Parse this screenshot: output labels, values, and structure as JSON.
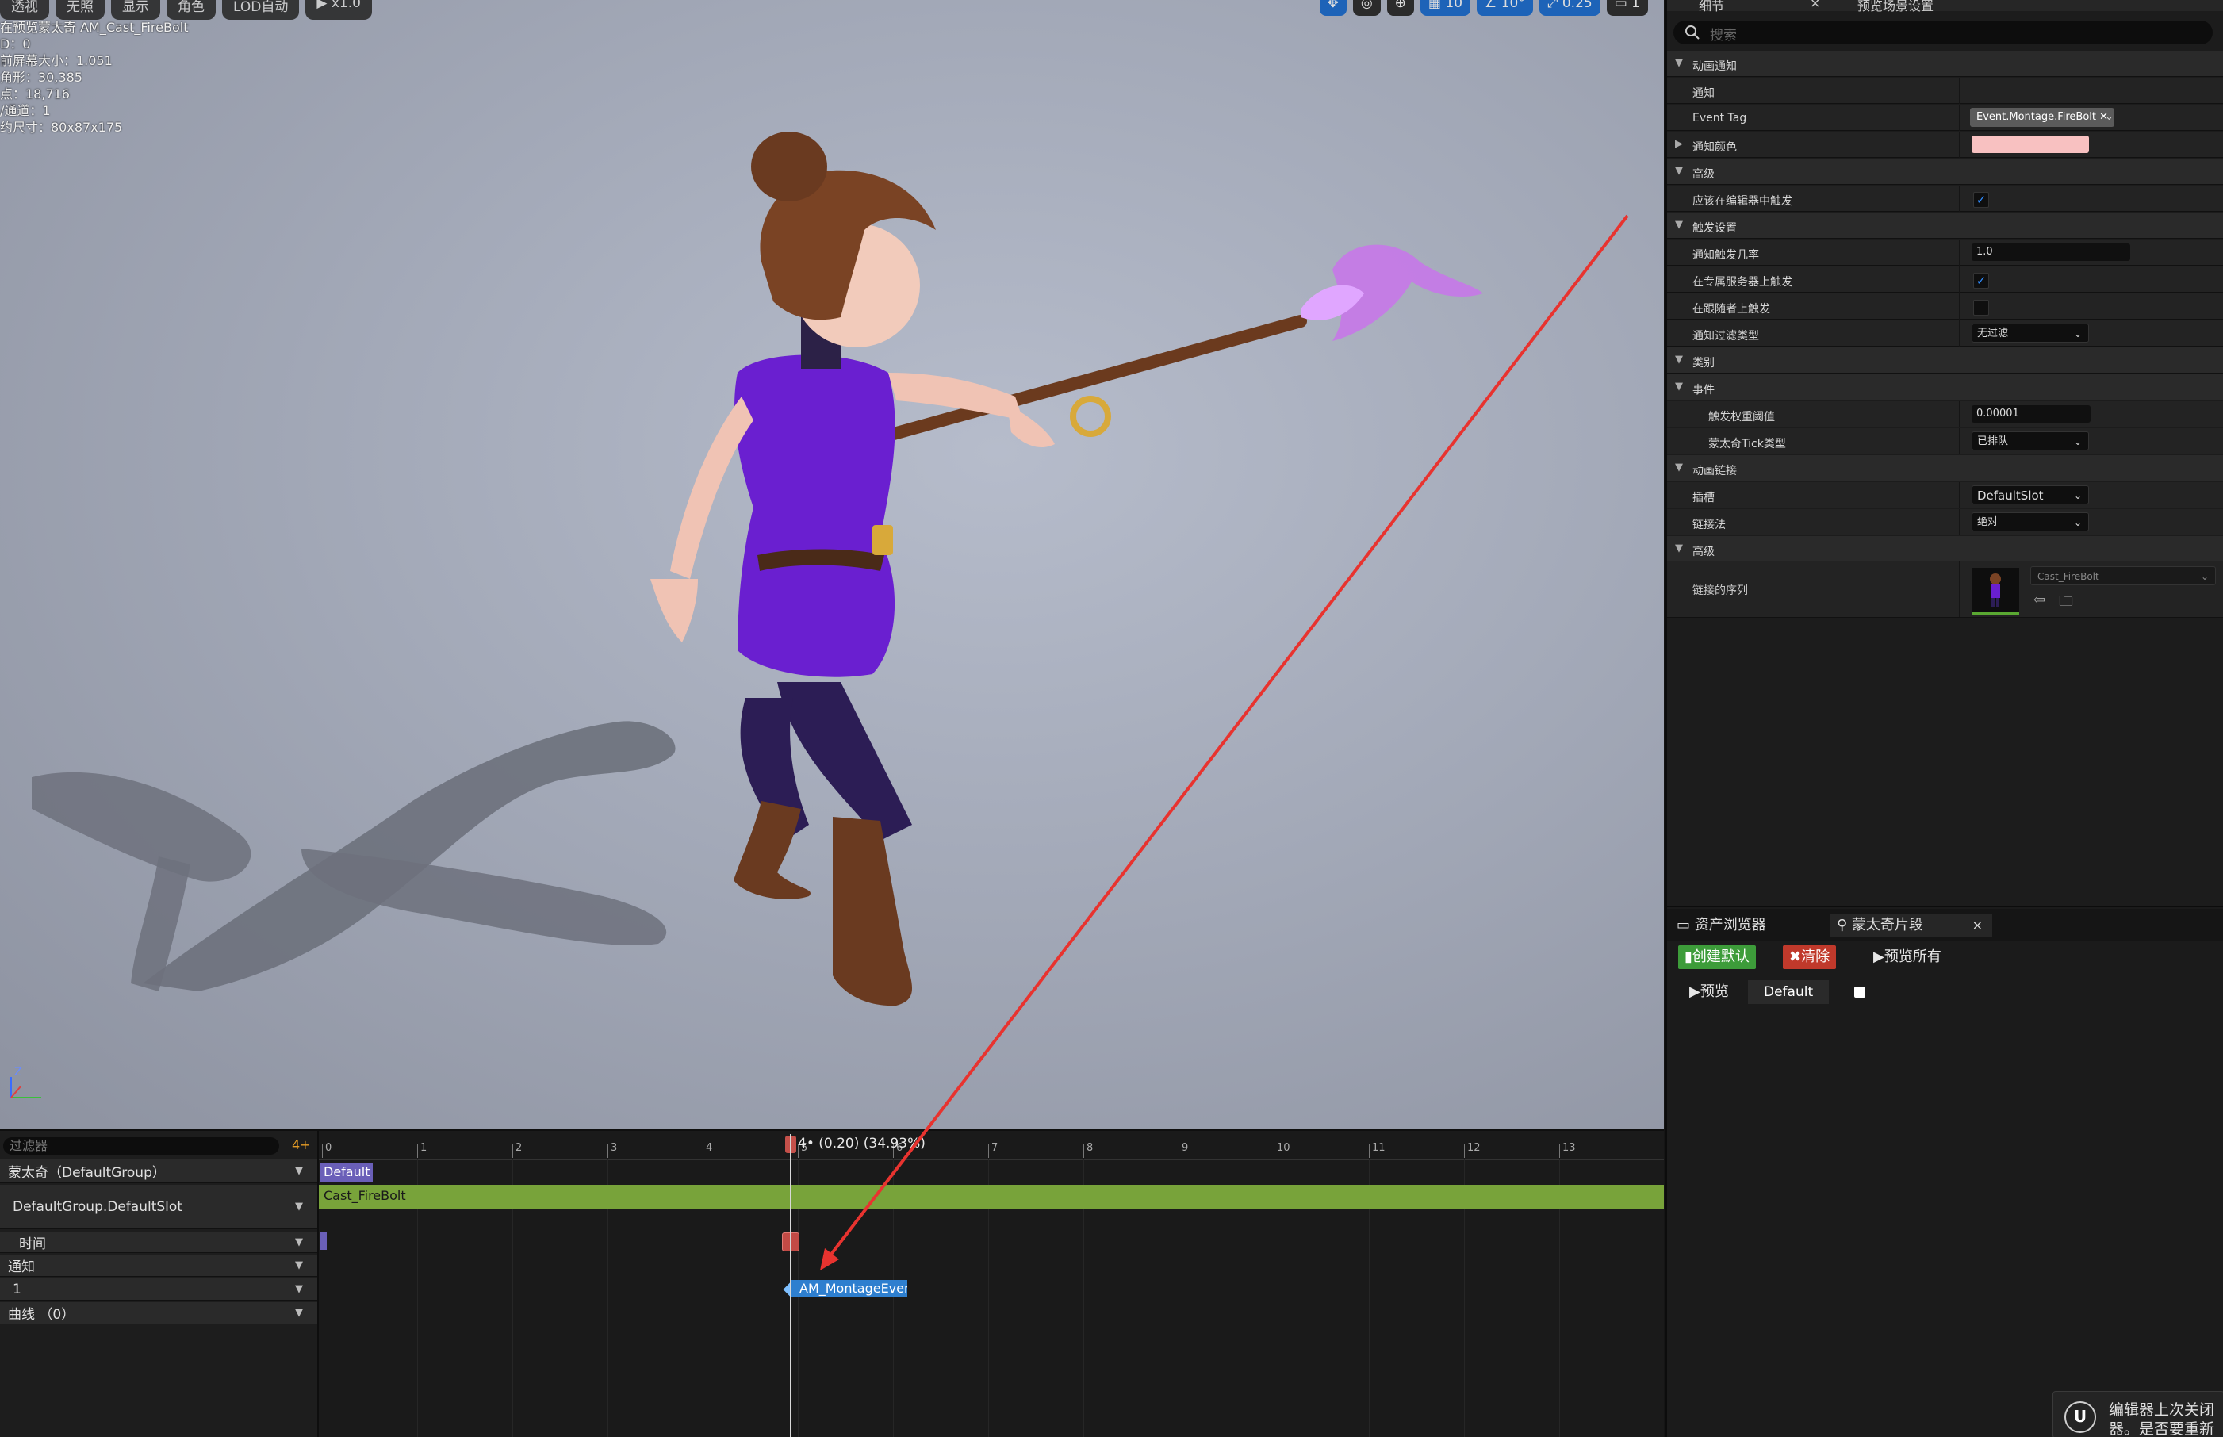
{
  "viewport": {
    "toolbar": [
      "透视",
      "无照",
      "显示",
      "角色",
      "LOD自动",
      "x1.0"
    ],
    "right_tools": [
      "10",
      "10°",
      "0.25",
      "1"
    ],
    "stats": [
      "在预览蒙太奇 AM_Cast_FireBolt",
      "D：0",
      "前屏幕大小：1.051",
      "角形：30,385",
      "点：18,716",
      "/通道：1",
      "约尺寸：80x87x175"
    ],
    "gizmo": "Z"
  },
  "timeline": {
    "filter_placeholder": "过滤器",
    "filter_add": "4+",
    "tracks": [
      {
        "label": "蒙太奇（DefaultGroup）"
      },
      {
        "label": "DefaultGroup.DefaultSlot"
      },
      {
        "label": "时间"
      },
      {
        "label": "通知"
      },
      {
        "label": "1"
      },
      {
        "label": "曲线 （0）"
      }
    ],
    "ticks": [
      "0",
      "1",
      "2",
      "3",
      "4",
      "5",
      "6",
      "7",
      "8",
      "9",
      "10",
      "11",
      "12",
      "13"
    ],
    "scrub_label": "4• (0.20) (34.93%)",
    "default_section": "Default",
    "segment_name": "Cast_FireBolt",
    "notify_name": "AM_MontageEvent",
    "colors": {
      "segment": "#78a33a",
      "notify": "#2e7fcf",
      "marker": "#c24a45",
      "section": "#6a5fb8"
    }
  },
  "details": {
    "tab1": "细节",
    "tab2": "预览场景设置",
    "search_placeholder": "搜索",
    "rows": {
      "anim_notify": "动画通知",
      "notify": "通知",
      "event_tag": "Event Tag",
      "event_tag_value": "Event.Montage.FireBolt",
      "notify_color": "通知颜色",
      "advanced": "高级",
      "trigger_in_editor": "应该在编辑器中触发",
      "trigger_settings": "触发设置",
      "trigger_chance": "通知触发几率",
      "trigger_chance_value": "1.0",
      "trigger_dedicated": "在专属服务器上触发",
      "trigger_follower": "在跟随者上触发",
      "filter_type": "通知过滤类型",
      "filter_type_value": "无过滤",
      "category": "类别",
      "event": "事件",
      "weight_threshold": "触发权重阈值",
      "weight_threshold_value": "0.00001",
      "tick_type": "蒙太奇Tick类型",
      "tick_type_value": "已排队",
      "anim_link": "动画链接",
      "slot": "插槽",
      "slot_value": "DefaultSlot",
      "link_method": "链接法",
      "link_method_value": "绝对",
      "advanced2": "高级",
      "linked_sequence": "链接的序列",
      "linked_sequence_value": "Cast_FireBolt"
    }
  },
  "sections": {
    "tab_assets": "资产浏览器",
    "tab_sections": "蒙太奇片段",
    "create_default": "创建默认",
    "clear": "清除",
    "preview_all": "预览所有",
    "preview": "预览",
    "default_chip": "Default"
  },
  "toast": {
    "line1": "编辑器上次关闭",
    "line2": "器。是否要重新"
  }
}
